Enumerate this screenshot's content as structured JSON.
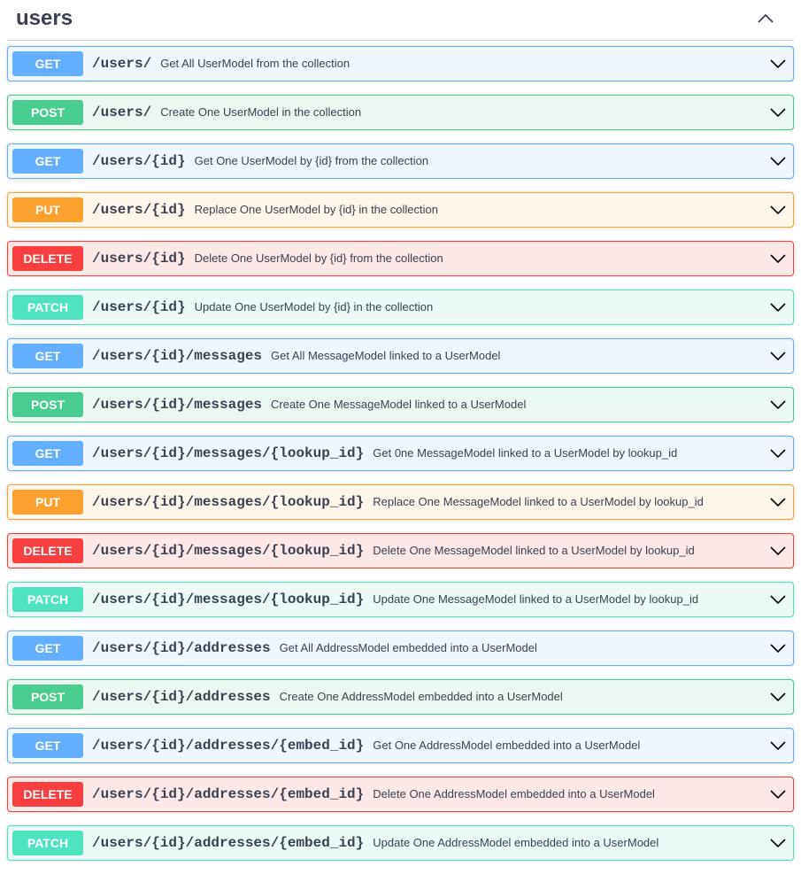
{
  "tag": {
    "title": "users",
    "toggle_icon": "chevron-up-icon"
  },
  "operations": [
    {
      "method": "GET",
      "path": "/users/",
      "summary": "Get All UserModel from the collection"
    },
    {
      "method": "POST",
      "path": "/users/",
      "summary": "Create One UserModel in the collection"
    },
    {
      "method": "GET",
      "path": "/users/{id}",
      "summary": "Get One UserModel by {id} from the collection"
    },
    {
      "method": "PUT",
      "path": "/users/{id}",
      "summary": "Replace One UserModel by {id} in the collection"
    },
    {
      "method": "DELETE",
      "path": "/users/{id}",
      "summary": "Delete One UserModel by {id} from the collection"
    },
    {
      "method": "PATCH",
      "path": "/users/{id}",
      "summary": "Update One UserModel by {id} in the collection"
    },
    {
      "method": "GET",
      "path": "/users/{id}/messages",
      "summary": "Get All MessageModel linked to a UserModel"
    },
    {
      "method": "POST",
      "path": "/users/{id}/messages",
      "summary": "Create One MessageModel linked to a UserModel"
    },
    {
      "method": "GET",
      "path": "/users/{id}/messages/{lookup_id}",
      "summary": "Get 0ne MessageModel linked to a UserModel by lookup_id"
    },
    {
      "method": "PUT",
      "path": "/users/{id}/messages/{lookup_id}",
      "summary": "Replace One MessageModel linked to a UserModel by lookup_id"
    },
    {
      "method": "DELETE",
      "path": "/users/{id}/messages/{lookup_id}",
      "summary": "Delete One MessageModel linked to a UserModel by lookup_id"
    },
    {
      "method": "PATCH",
      "path": "/users/{id}/messages/{lookup_id}",
      "summary": "Update One MessageModel linked to a UserModel by lookup_id"
    },
    {
      "method": "GET",
      "path": "/users/{id}/addresses",
      "summary": "Get All AddressModel embedded into a UserModel"
    },
    {
      "method": "POST",
      "path": "/users/{id}/addresses",
      "summary": "Create One AddressModel embedded into a UserModel"
    },
    {
      "method": "GET",
      "path": "/users/{id}/addresses/{embed_id}",
      "summary": "Get One AddressModel embedded into a UserModel"
    },
    {
      "method": "DELETE",
      "path": "/users/{id}/addresses/{embed_id}",
      "summary": "Delete One AddressModel embedded into a UserModel"
    },
    {
      "method": "PATCH",
      "path": "/users/{id}/addresses/{embed_id}",
      "summary": "Update One AddressModel embedded into a UserModel"
    }
  ],
  "expand_icon": "chevron-down-icon",
  "colors": {
    "GET": "#61affe",
    "POST": "#49cc90",
    "PUT": "#fca130",
    "DELETE": "#f93e3e",
    "PATCH": "#50e3c2",
    "text": "#3b4151"
  }
}
